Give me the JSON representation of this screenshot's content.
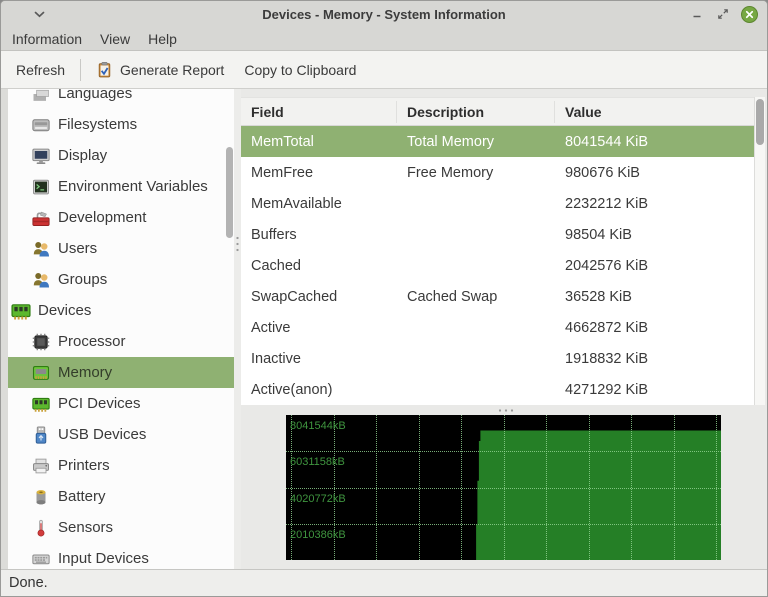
{
  "window": {
    "title": "Devices - Memory - System Information",
    "control_icons": [
      "window-menu-icon",
      "minimize-icon",
      "restore-icon",
      "close-icon"
    ]
  },
  "menubar": {
    "items": [
      {
        "label": "Information"
      },
      {
        "label": "View"
      },
      {
        "label": "Help"
      }
    ]
  },
  "toolbar": {
    "refresh_label": "Refresh",
    "generate_report_label": "Generate Report",
    "generate_report_icon": "clipboard-check-icon",
    "copy_label": "Copy to Clipboard"
  },
  "sidebar": {
    "items": [
      {
        "label": "Languages",
        "icon": "languages-icon",
        "level": 1,
        "selected": false,
        "clipped": "top"
      },
      {
        "label": "Filesystems",
        "icon": "filesystems-icon",
        "level": 1,
        "selected": false
      },
      {
        "label": "Display",
        "icon": "display-icon",
        "level": 1,
        "selected": false
      },
      {
        "label": "Environment Variables",
        "icon": "environment-variables-icon",
        "level": 1,
        "selected": false
      },
      {
        "label": "Development",
        "icon": "development-icon",
        "level": 1,
        "selected": false
      },
      {
        "label": "Users",
        "icon": "users-icon",
        "level": 1,
        "selected": false
      },
      {
        "label": "Groups",
        "icon": "groups-icon",
        "level": 1,
        "selected": false
      },
      {
        "label": "Devices",
        "icon": "devices-icon",
        "level": 0,
        "selected": false
      },
      {
        "label": "Processor",
        "icon": "processor-icon",
        "level": 1,
        "selected": false
      },
      {
        "label": "Memory",
        "icon": "memory-icon",
        "level": 1,
        "selected": true
      },
      {
        "label": "PCI Devices",
        "icon": "pci-devices-icon",
        "level": 1,
        "selected": false
      },
      {
        "label": "USB Devices",
        "icon": "usb-devices-icon",
        "level": 1,
        "selected": false
      },
      {
        "label": "Printers",
        "icon": "printers-icon",
        "level": 1,
        "selected": false
      },
      {
        "label": "Battery",
        "icon": "battery-icon",
        "level": 1,
        "selected": false
      },
      {
        "label": "Sensors",
        "icon": "sensors-icon",
        "level": 1,
        "selected": false
      },
      {
        "label": "Input Devices",
        "icon": "input-devices-icon",
        "level": 1,
        "selected": false,
        "clipped": "bottom"
      }
    ]
  },
  "table": {
    "columns": [
      "Field",
      "Description",
      "Value"
    ],
    "rows": [
      {
        "field": "MemTotal",
        "description": "Total Memory",
        "value": "8041544 KiB",
        "selected": true
      },
      {
        "field": "MemFree",
        "description": "Free Memory",
        "value": "980676 KiB",
        "selected": false
      },
      {
        "field": "MemAvailable",
        "description": "",
        "value": "2232212 KiB",
        "selected": false
      },
      {
        "field": "Buffers",
        "description": "",
        "value": "98504 KiB",
        "selected": false
      },
      {
        "field": "Cached",
        "description": "",
        "value": "2042576 KiB",
        "selected": false
      },
      {
        "field": "SwapCached",
        "description": "Cached Swap",
        "value": "36528 KiB",
        "selected": false
      },
      {
        "field": "Active",
        "description": "",
        "value": "4662872 KiB",
        "selected": false
      },
      {
        "field": "Inactive",
        "description": "",
        "value": "1918832 KiB",
        "selected": false
      },
      {
        "field": "Active(anon)",
        "description": "",
        "value": "4271292 KiB",
        "selected": false
      }
    ]
  },
  "chart_data": {
    "type": "area",
    "title": "",
    "y_tick_labels": [
      "8041544kB",
      "6031158kB",
      "4020772kB",
      "2010386kB"
    ],
    "y_gridline_values": [
      8041544,
      6031158,
      4020772,
      2010386
    ],
    "ylim": [
      0,
      8041544
    ],
    "grid": true,
    "legend": false,
    "background": "#000000",
    "v_gridline_count": 11,
    "series": [
      {
        "name": "used-memory",
        "color": "#257f26",
        "current_value_kb": 7182000,
        "data_start_x_fraction": 0.437,
        "points": [
          {
            "x": 0.437,
            "v": 0
          },
          {
            "x": 0.437,
            "v": 1950000
          },
          {
            "x": 0.44,
            "v": 1950000
          },
          {
            "x": 0.44,
            "v": 4400000
          },
          {
            "x": 0.4435,
            "v": 4400000
          },
          {
            "x": 0.4435,
            "v": 6600000
          },
          {
            "x": 0.447,
            "v": 6600000
          },
          {
            "x": 0.447,
            "v": 7182000
          },
          {
            "x": 0.451,
            "v": 7182000
          },
          {
            "x": 1.0,
            "v": 7182000
          },
          {
            "x": 1.0,
            "v": 0
          }
        ]
      }
    ]
  },
  "statusbar": {
    "text": "Done."
  },
  "colors": {
    "selection_green": "#8fb172",
    "close_button_green": "#77a843",
    "chart_fill_green": "#257f26",
    "chart_grid_green": "rgba(150,215,150,0.8)",
    "chart_label_green": "#3f953f",
    "titlebar_gray": "#d7d7d4"
  }
}
